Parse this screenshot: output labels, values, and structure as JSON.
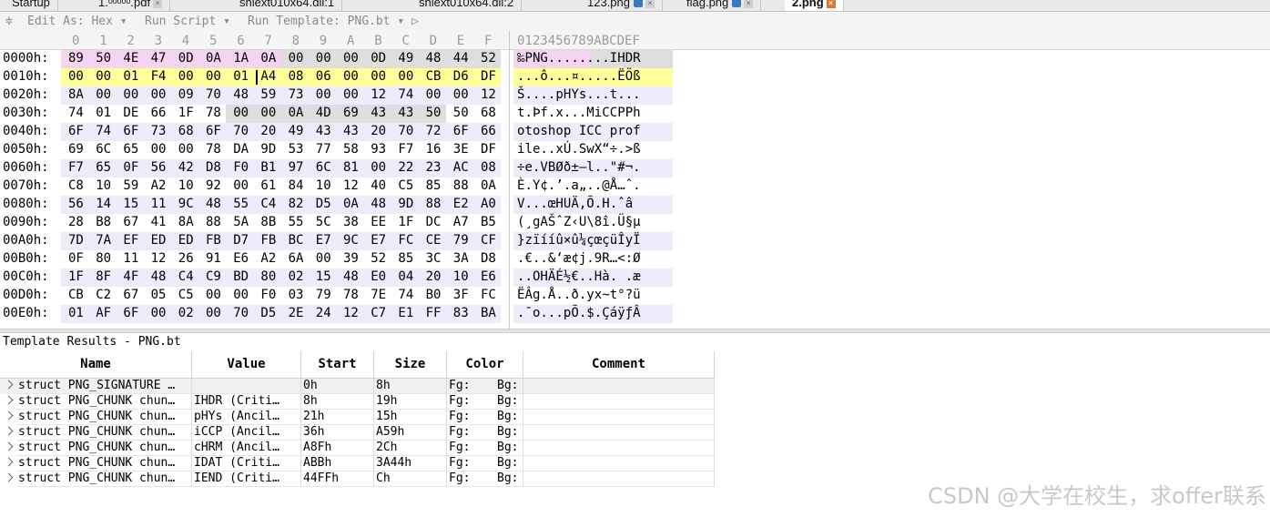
{
  "tabs": [
    {
      "label": "Startup",
      "lock": false,
      "close": false
    },
    {
      "label": "1.ᵒᵒᵒᵒᵒ.pdf",
      "lock": false,
      "close": true
    },
    {
      "label": "shlext010x64.dll:1",
      "lock": false,
      "close": false
    },
    {
      "label": "shlext010x64.dll:2",
      "lock": false,
      "close": false
    },
    {
      "label": "123.png",
      "lock": true,
      "close": true
    },
    {
      "label": "flag.png",
      "lock": true,
      "close": true
    },
    {
      "label": "2.png",
      "lock": false,
      "close": true,
      "active": true
    }
  ],
  "toolbar": {
    "edit_as": "Edit As: Hex ▾",
    "run_script": "Run Script ▾",
    "run_template": "Run Template: PNG.bt ▾ ▷"
  },
  "header": {
    "hex_cols": [
      "0",
      "1",
      "2",
      "3",
      "4",
      "5",
      "6",
      "7",
      "8",
      "9",
      "A",
      "B",
      "C",
      "D",
      "E",
      "F"
    ],
    "ascii_cols": "0123456789ABCDEF"
  },
  "rows": [
    {
      "addr": "0000h:",
      "bytes": [
        "89",
        "50",
        "4E",
        "47",
        "0D",
        "0A",
        "1A",
        "0A",
        "00",
        "00",
        "00",
        "0D",
        "49",
        "48",
        "44",
        "52"
      ],
      "ascii": "‰PNG........IHDR"
    },
    {
      "addr": "0010h:",
      "bytes": [
        "00",
        "00",
        "01",
        "F4",
        "00",
        "00",
        "01",
        "A4",
        "08",
        "06",
        "00",
        "00",
        "00",
        "CB",
        "D6",
        "DF"
      ],
      "ascii": "...ô...¤.....ËÖß"
    },
    {
      "addr": "0020h:",
      "bytes": [
        "8A",
        "00",
        "00",
        "00",
        "09",
        "70",
        "48",
        "59",
        "73",
        "00",
        "00",
        "12",
        "74",
        "00",
        "00",
        "12"
      ],
      "ascii": "Š....pHYs...t..."
    },
    {
      "addr": "0030h:",
      "bytes": [
        "74",
        "01",
        "DE",
        "66",
        "1F",
        "78",
        "00",
        "00",
        "0A",
        "4D",
        "69",
        "43",
        "43",
        "50",
        "50",
        "68"
      ],
      "ascii": "t.Þf.x...MiCCPPh"
    },
    {
      "addr": "0040h:",
      "bytes": [
        "6F",
        "74",
        "6F",
        "73",
        "68",
        "6F",
        "70",
        "20",
        "49",
        "43",
        "43",
        "20",
        "70",
        "72",
        "6F",
        "66"
      ],
      "ascii": "otoshop ICC prof"
    },
    {
      "addr": "0050h:",
      "bytes": [
        "69",
        "6C",
        "65",
        "00",
        "00",
        "78",
        "DA",
        "9D",
        "53",
        "77",
        "58",
        "93",
        "F7",
        "16",
        "3E",
        "DF"
      ],
      "ascii": "ile..xÚ.SwX“÷.>ß"
    },
    {
      "addr": "0060h:",
      "bytes": [
        "F7",
        "65",
        "0F",
        "56",
        "42",
        "D8",
        "F0",
        "B1",
        "97",
        "6C",
        "81",
        "00",
        "22",
        "23",
        "AC",
        "08"
      ],
      "ascii": "÷e.VBØð±—l..\"#¬."
    },
    {
      "addr": "0070h:",
      "bytes": [
        "C8",
        "10",
        "59",
        "A2",
        "10",
        "92",
        "00",
        "61",
        "84",
        "10",
        "12",
        "40",
        "C5",
        "85",
        "88",
        "0A"
      ],
      "ascii": "È.Y¢.’.a„..@Å…ˆ."
    },
    {
      "addr": "0080h:",
      "bytes": [
        "56",
        "14",
        "15",
        "11",
        "9C",
        "48",
        "55",
        "C4",
        "82",
        "D5",
        "0A",
        "48",
        "9D",
        "88",
        "E2",
        "A0"
      ],
      "ascii": "V...œHUÄ‚Õ.H.ˆâ "
    },
    {
      "addr": "0090h:",
      "bytes": [
        "28",
        "B8",
        "67",
        "41",
        "8A",
        "88",
        "5A",
        "8B",
        "55",
        "5C",
        "38",
        "EE",
        "1F",
        "DC",
        "A7",
        "B5"
      ],
      "ascii": "(¸gAŠˆZ‹U\\8î.Ü§µ"
    },
    {
      "addr": "00A0h:",
      "bytes": [
        "7D",
        "7A",
        "EF",
        "ED",
        "ED",
        "FB",
        "D7",
        "FB",
        "BC",
        "E7",
        "9C",
        "E7",
        "FC",
        "CE",
        "79",
        "CF"
      ],
      "ascii": "}zïííû×û¼çœçüÎyÏ"
    },
    {
      "addr": "00B0h:",
      "bytes": [
        "0F",
        "80",
        "11",
        "12",
        "26",
        "91",
        "E6",
        "A2",
        "6A",
        "00",
        "39",
        "52",
        "85",
        "3C",
        "3A",
        "D8"
      ],
      "ascii": ".€..&‘æ¢j.9R…<:Ø"
    },
    {
      "addr": "00C0h:",
      "bytes": [
        "1F",
        "8F",
        "4F",
        "48",
        "C4",
        "C9",
        "BD",
        "80",
        "02",
        "15",
        "48",
        "E0",
        "04",
        "20",
        "10",
        "E6"
      ],
      "ascii": "..OHÄÉ½€..Hà. .æ"
    },
    {
      "addr": "00D0h:",
      "bytes": [
        "CB",
        "C2",
        "67",
        "05",
        "C5",
        "00",
        "00",
        "F0",
        "03",
        "79",
        "78",
        "7E",
        "74",
        "B0",
        "3F",
        "FC"
      ],
      "ascii": "ËÂg.Å..ð.yx~t°?ü"
    },
    {
      "addr": "00E0h:",
      "bytes": [
        "01",
        "AF",
        "6F",
        "00",
        "02",
        "00",
        "70",
        "D5",
        "2E",
        "24",
        "12",
        "C7",
        "E1",
        "FF",
        "83",
        "BA"
      ],
      "ascii": ".¯o...pÕ.$.ÇáÿƒÂ"
    }
  ],
  "template": {
    "title": "Template Results - PNG.bt",
    "columns": [
      "Name",
      "Value",
      "Start",
      "Size",
      "Color",
      "Comment"
    ],
    "rows": [
      {
        "name": "struct PNG_SIGNATURE …",
        "value": "",
        "start": "0h",
        "size": "8h",
        "fg": "Fg:",
        "bg": "Bg:"
      },
      {
        "name": "struct PNG_CHUNK chun…",
        "value": "IHDR  (Criti…",
        "start": "8h",
        "size": "19h",
        "fg": "Fg:",
        "bg": "Bg:"
      },
      {
        "name": "struct PNG_CHUNK chun…",
        "value": "pHYs  (Ancil…",
        "start": "21h",
        "size": "15h",
        "fg": "Fg:",
        "bg": "Bg:"
      },
      {
        "name": "struct PNG_CHUNK chun…",
        "value": "iCCP  (Ancil…",
        "start": "36h",
        "size": "A59h",
        "fg": "Fg:",
        "bg": "Bg:"
      },
      {
        "name": "struct PNG_CHUNK chun…",
        "value": "cHRM  (Ancil…",
        "start": "A8Fh",
        "size": "2Ch",
        "fg": "Fg:",
        "bg": "Bg:"
      },
      {
        "name": "struct PNG_CHUNK chun…",
        "value": "IDAT  (Criti…",
        "start": "ABBh",
        "size": "3A44h",
        "fg": "Fg:",
        "bg": "Bg:"
      },
      {
        "name": "struct PNG_CHUNK chun…",
        "value": "IEND  (Criti…",
        "start": "44FFh",
        "size": "Ch",
        "fg": "Fg:",
        "bg": "Bg:"
      }
    ]
  },
  "watermark": "CSDN @大学在校生，求offer联系",
  "colors": {
    "signature": "#f5d4f2",
    "ihdr": "#ffff99",
    "gray_chunkhdr": "#dedede",
    "row_alt": "#ececfb",
    "row_plain": "#ffffff"
  }
}
